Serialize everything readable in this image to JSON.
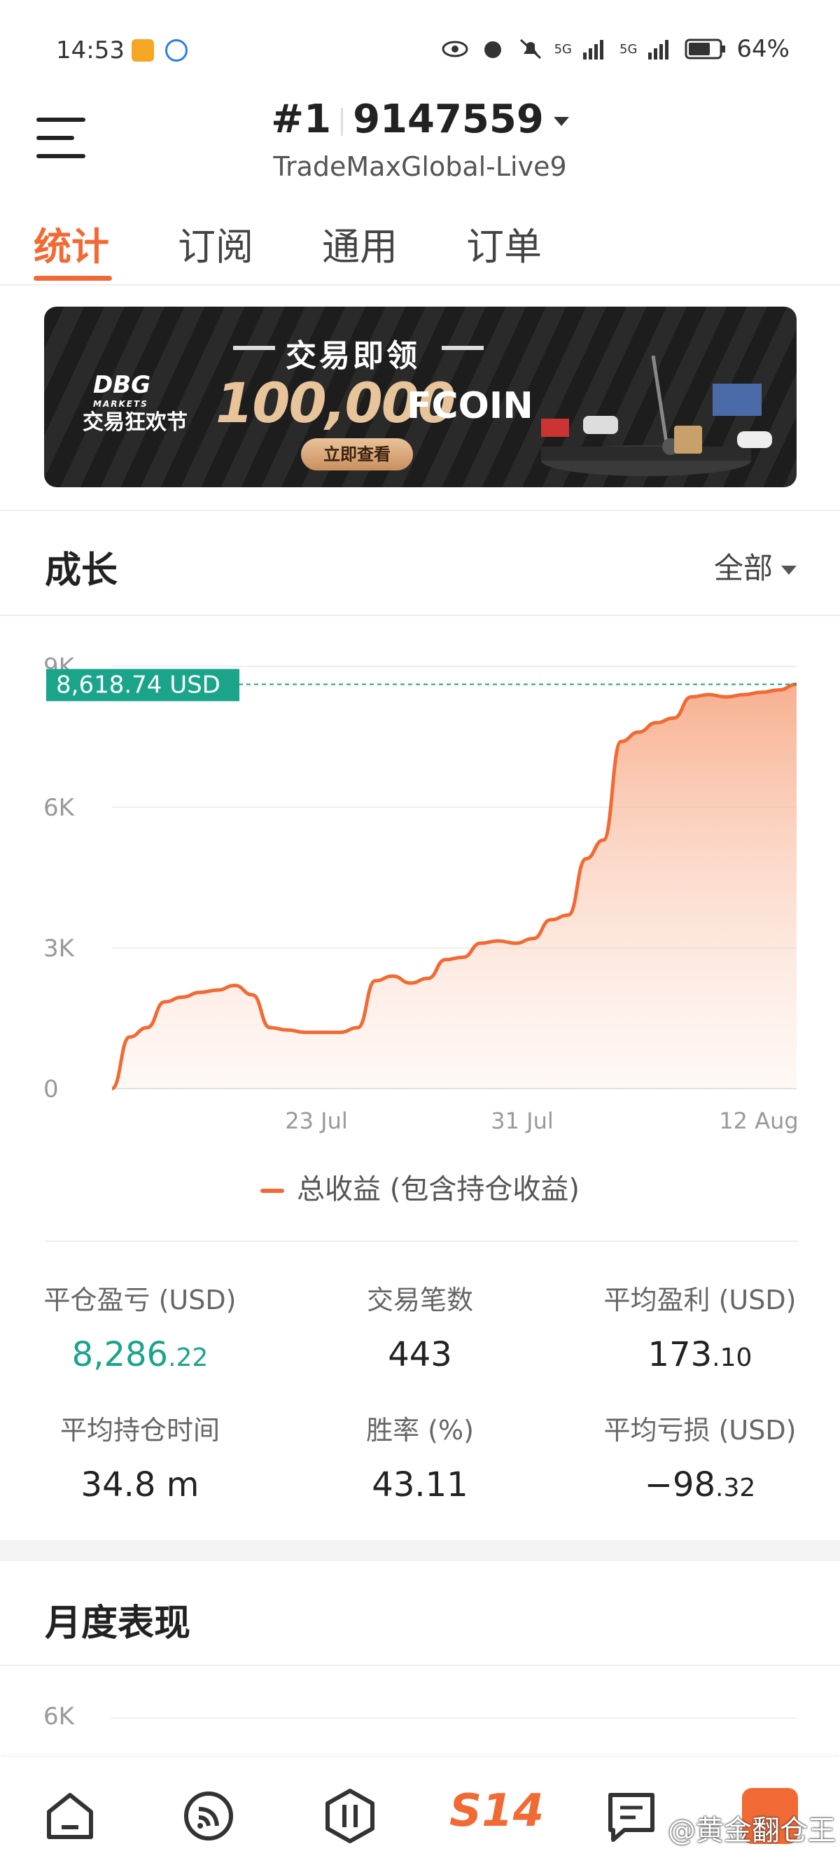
{
  "status_bar": {
    "time": "14:53",
    "battery": "64%",
    "signal_1": "5G",
    "signal_2": "5G"
  },
  "header": {
    "account_rank": "#1",
    "account_number": "9147559",
    "server": "TradeMaxGlobal-Live9"
  },
  "tabs": [
    {
      "label": "统计",
      "active": true
    },
    {
      "label": "订阅",
      "active": false
    },
    {
      "label": "通用",
      "active": false
    },
    {
      "label": "订单",
      "active": false
    }
  ],
  "banner": {
    "brand": "DBG",
    "brand_sub": "MARKETS",
    "festival": "交易狂欢节",
    "headline": "交易即领",
    "amount": "100,000",
    "currency": "FCOIN",
    "cta": "立即查看"
  },
  "growth": {
    "title": "成长",
    "scope": "全部",
    "legend": "总收益 (包含持仓收益)"
  },
  "chart_data": {
    "type": "area",
    "current_value_label": "8,618.74 USD",
    "current_value": 8618.74,
    "y_ticks": [
      "0",
      "3K",
      "6K",
      "9K"
    ],
    "ylim": [
      0,
      9000
    ],
    "x_ticks": [
      "23 Jul",
      "31 Jul",
      "12 Aug"
    ],
    "series": [
      {
        "name": "总收益 (包含持仓收益)",
        "color": "#f26a33",
        "values": [
          0,
          1100,
          1300,
          1850,
          1950,
          2050,
          2100,
          2200,
          2000,
          1300,
          1250,
          1200,
          1200,
          1200,
          1300,
          2300,
          2400,
          2250,
          2350,
          2750,
          2800,
          3100,
          3150,
          3100,
          3200,
          3600,
          3700,
          4900,
          5300,
          7400,
          7600,
          7800,
          7900,
          8350,
          8400,
          8350,
          8400,
          8450,
          8500,
          8618.74
        ]
      }
    ],
    "grid": true
  },
  "stats": [
    {
      "label": "平仓盈亏 (USD)",
      "int": "8,286",
      "dec": ".22",
      "positive": true
    },
    {
      "label": "交易笔数",
      "int": "443",
      "dec": "",
      "positive": false
    },
    {
      "label": "平均盈利 (USD)",
      "int": "173",
      "dec": ".10",
      "positive": false
    },
    {
      "label": "平均持仓时间",
      "int": "34.8 m",
      "dec": "",
      "positive": false
    },
    {
      "label": "胜率 (%)",
      "int": "43.11",
      "dec": "",
      "positive": false
    },
    {
      "label": "平均亏损 (USD)",
      "int": "−98",
      "dec": ".32",
      "positive": false
    }
  ],
  "monthly": {
    "title": "月度表现",
    "y_tick": "6K"
  },
  "bottom_nav": {
    "s14": "S14",
    "watermark": "@黄金翻仓王"
  },
  "icons": [
    "eye-icon",
    "alarm-icon",
    "mute-icon",
    "signal-icon",
    "battery-icon",
    "menu-icon",
    "home-icon",
    "feed-icon",
    "trade-icon",
    "chat-icon",
    "profile-icon"
  ]
}
